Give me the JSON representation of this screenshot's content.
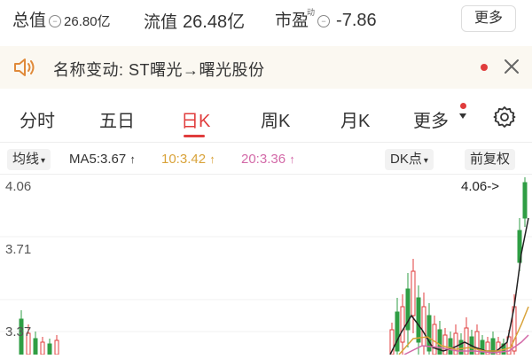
{
  "valuation": {
    "total_label": "总值",
    "total_value": "26.80亿",
    "float_label": "流值",
    "float_value": "26.48亿",
    "pe_label": "市盈",
    "pe_super": "动",
    "pe_value": "-7.86",
    "more_label": "更多"
  },
  "notice": {
    "text": "名称变动: ST曙光→曙光股份"
  },
  "tabs": [
    {
      "label": "分时"
    },
    {
      "label": "五日"
    },
    {
      "label": "日K"
    },
    {
      "label": "周K"
    },
    {
      "label": "月K"
    },
    {
      "label": "更多"
    }
  ],
  "ma_bar": {
    "type_label": "均线",
    "ma5": "MA5:3.67",
    "ma10": "10:3.42",
    "ma20": "20:3.36",
    "dk_label": "DK点",
    "adjust_label": "前复权"
  },
  "chart_data": {
    "type": "candlestick",
    "y_ticks": [
      "4.06",
      "3.71",
      "3.37"
    ],
    "price_marker": "4.06->",
    "colors": {
      "up": "#e03c3c",
      "down": "#2f9e44",
      "ma5": "#222222",
      "ma10": "#d9a33a",
      "ma20": "#d36aa8"
    }
  },
  "colors": {
    "accent": "#e03c3c",
    "banner_bg": "#fbf8f1"
  }
}
